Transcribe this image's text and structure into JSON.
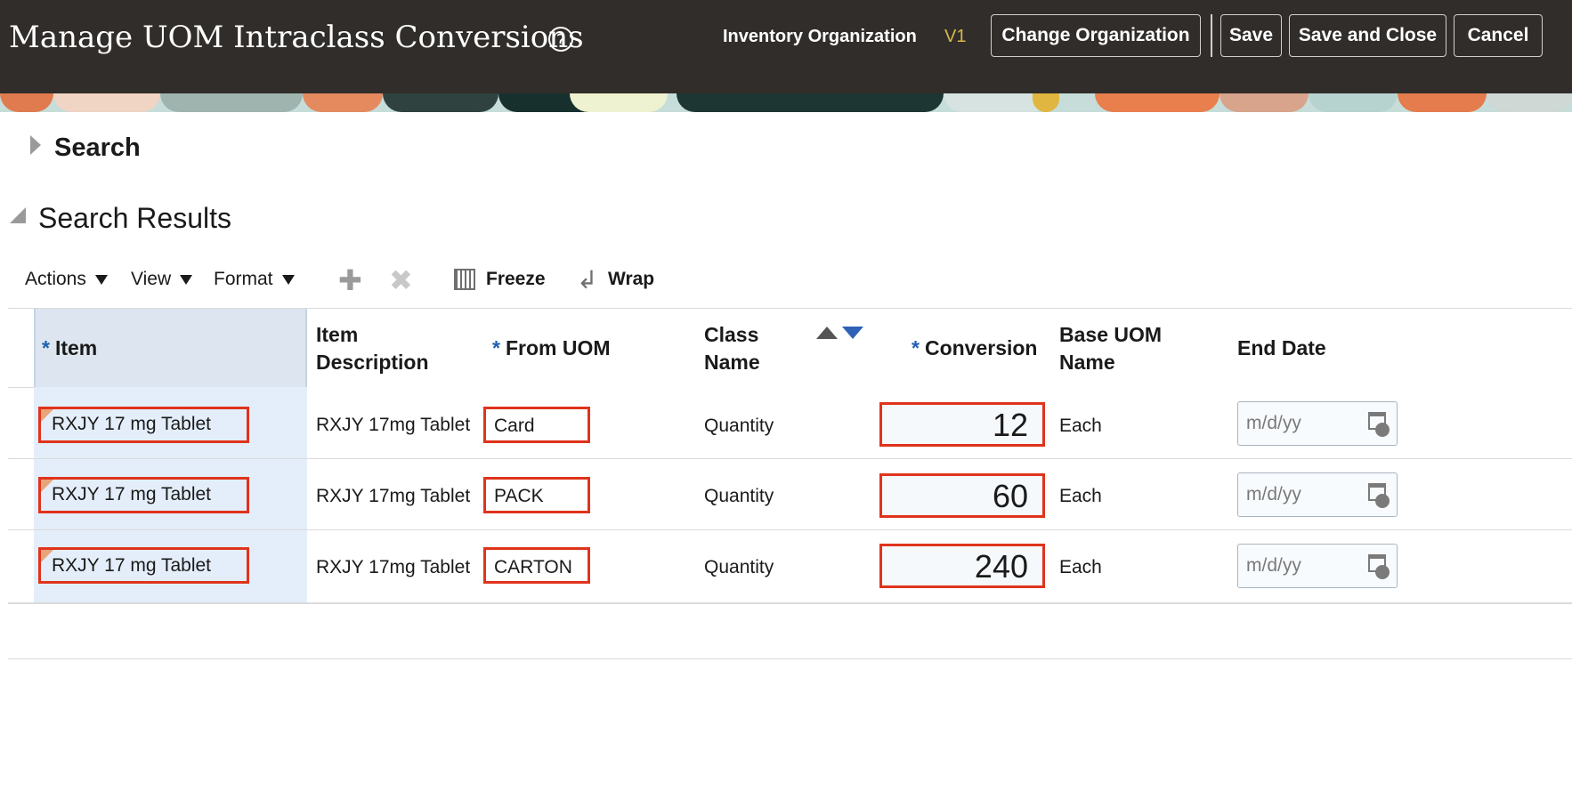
{
  "header": {
    "title": "Manage UOM Intraclass Conversions",
    "help_icon": "help-icon",
    "org_label": "Inventory Organization",
    "org_value": "V1",
    "change_org_label": "Change Organization",
    "save_label": "Save",
    "save_close_label": "Save and Close",
    "cancel_label": "Cancel"
  },
  "search": {
    "title": "Search"
  },
  "results": {
    "title": "Search Results",
    "toolbar": {
      "actions": "Actions",
      "view": "View",
      "format": "Format",
      "add_icon": "plus-icon",
      "delete_icon": "close-icon",
      "freeze": "Freeze",
      "wrap": "Wrap"
    },
    "columns": {
      "item": "Item",
      "item_description_1": "Item",
      "item_description_2": "Description",
      "from_uom": "From UOM",
      "class_name_1": "Class",
      "class_name_2": "Name",
      "conversion": "Conversion",
      "base_uom_1": "Base UOM",
      "base_uom_2": "Name",
      "end_date": "End Date",
      "required_marker": "*"
    },
    "rows": [
      {
        "item": "RXJY 17 mg Tablet",
        "description": "RXJY 17mg Tablet",
        "from_uom": "Card",
        "class_name": "Quantity",
        "conversion": "12",
        "base_uom": "Each",
        "end_date_placeholder": "m/d/yy"
      },
      {
        "item": "RXJY 17 mg Tablet",
        "description": "RXJY 17mg Tablet",
        "from_uom": "PACK",
        "class_name": "Quantity",
        "conversion": "60",
        "base_uom": "Each",
        "end_date_placeholder": "m/d/yy"
      },
      {
        "item": "RXJY 17 mg Tablet",
        "description": "RXJY 17mg Tablet",
        "from_uom": "CARTON",
        "class_name": "Quantity",
        "conversion": "240",
        "base_uom": "Each",
        "end_date_placeholder": "m/d/yy"
      }
    ]
  },
  "colors": {
    "header_bg": "#312d2a",
    "highlight": "#e0331c",
    "org_value": "#d9b94b",
    "required": "#1f5fb0"
  }
}
